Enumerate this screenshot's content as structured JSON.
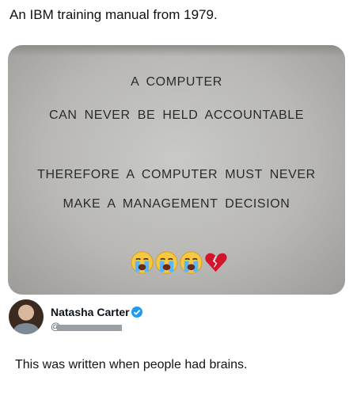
{
  "post": {
    "caption": "An IBM training manual from 1979."
  },
  "manual_photo": {
    "line1": "A COMPUTER",
    "line2": "CAN NEVER BE HELD ACCOUNTABLE",
    "line3": "THEREFORE A COMPUTER MUST NEVER",
    "line4": "MAKE A MANAGEMENT DECISION",
    "emoji_names": [
      "loudly-crying-face-icon",
      "loudly-crying-face-icon",
      "loudly-crying-face-icon",
      "broken-heart-icon"
    ]
  },
  "reply": {
    "author_name": "Natasha Carter",
    "handle_prefix": "@",
    "text": "This was written when people had brains.",
    "verified_color": "#1d9bf0"
  }
}
